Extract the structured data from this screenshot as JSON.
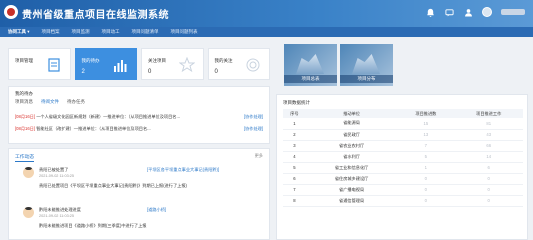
{
  "header": {
    "title": "贵州省级重点项目在线监测系统"
  },
  "nav": {
    "items": [
      "协同工具 ▾",
      "项目档案",
      "项目监测",
      "项目动工",
      "项目问题清单",
      "项目问题列表"
    ]
  },
  "cards": [
    {
      "label": "项目管理",
      "value": "",
      "icon": "document-icon"
    },
    {
      "label": "我的待办",
      "value": "2",
      "icon": "bar-chart-icon"
    },
    {
      "label": "关注项目",
      "value": "0",
      "icon": "star-icon"
    },
    {
      "label": "我的关注",
      "value": "0",
      "icon": "target-icon"
    }
  ],
  "tiles": [
    {
      "label": "项目总表"
    },
    {
      "label": "项目分布"
    }
  ],
  "reminder": {
    "title": "我的待办",
    "tabs": [
      "项目消息",
      "待阅文件",
      "待办任务"
    ],
    "rows": [
      {
        "tag": "[08月16日]",
        "text": "一个人省级文化园区新规划（新建）—推进单位：（从项目推进单位及项目名...",
        "link": "[协作处理]"
      },
      {
        "tag": "[08月16日]",
        "text": "智能社区（改扩建）—推进单位：（从项目推进单位及项目名...",
        "link": "[协作处理]"
      }
    ]
  },
  "activity": {
    "title": "工作动态",
    "more": "更多",
    "items": [
      {
        "who": "贵阳已被处置了",
        "time": "2021-09-02 11:03:25",
        "link": "[平坝区各平坝重点事业大事记(贵阳黔)]",
        "desc": "贵阳已处置项目《平坝区平坝重点事业大事记(贵阳黔)》到期已上报(进行了上报)"
      },
      {
        "who": "黔阳未能推进处理进度",
        "time": "2021-09-02 11:03:25",
        "link": "[道路小桥]",
        "desc": "黔阳未能推进项目《道路小桥》到期(三季度)中进行了上报"
      }
    ]
  },
  "stats": {
    "title": "项目数据统计",
    "columns": [
      "序号",
      "推动单位",
      "项目推进数",
      "项目推进工作"
    ],
    "rows": [
      {
        "no": "1",
        "unit": "省能源局",
        "count": "15",
        "work": "81"
      },
      {
        "no": "2",
        "unit": "省民政厅",
        "count": "13",
        "work": "43"
      },
      {
        "no": "3",
        "unit": "省农业农村厅",
        "count": "7",
        "work": "66"
      },
      {
        "no": "4",
        "unit": "省水利厅",
        "count": "5",
        "work": "14"
      },
      {
        "no": "5",
        "unit": "省工业和信息化厅",
        "count": "1",
        "work": "6"
      },
      {
        "no": "6",
        "unit": "省住房城乡建设厅",
        "count": "0",
        "work": "0"
      },
      {
        "no": "7",
        "unit": "省广播电视局",
        "count": "0",
        "work": "0"
      },
      {
        "no": "8",
        "unit": "省通信管理局",
        "count": "0",
        "work": "0"
      }
    ]
  }
}
